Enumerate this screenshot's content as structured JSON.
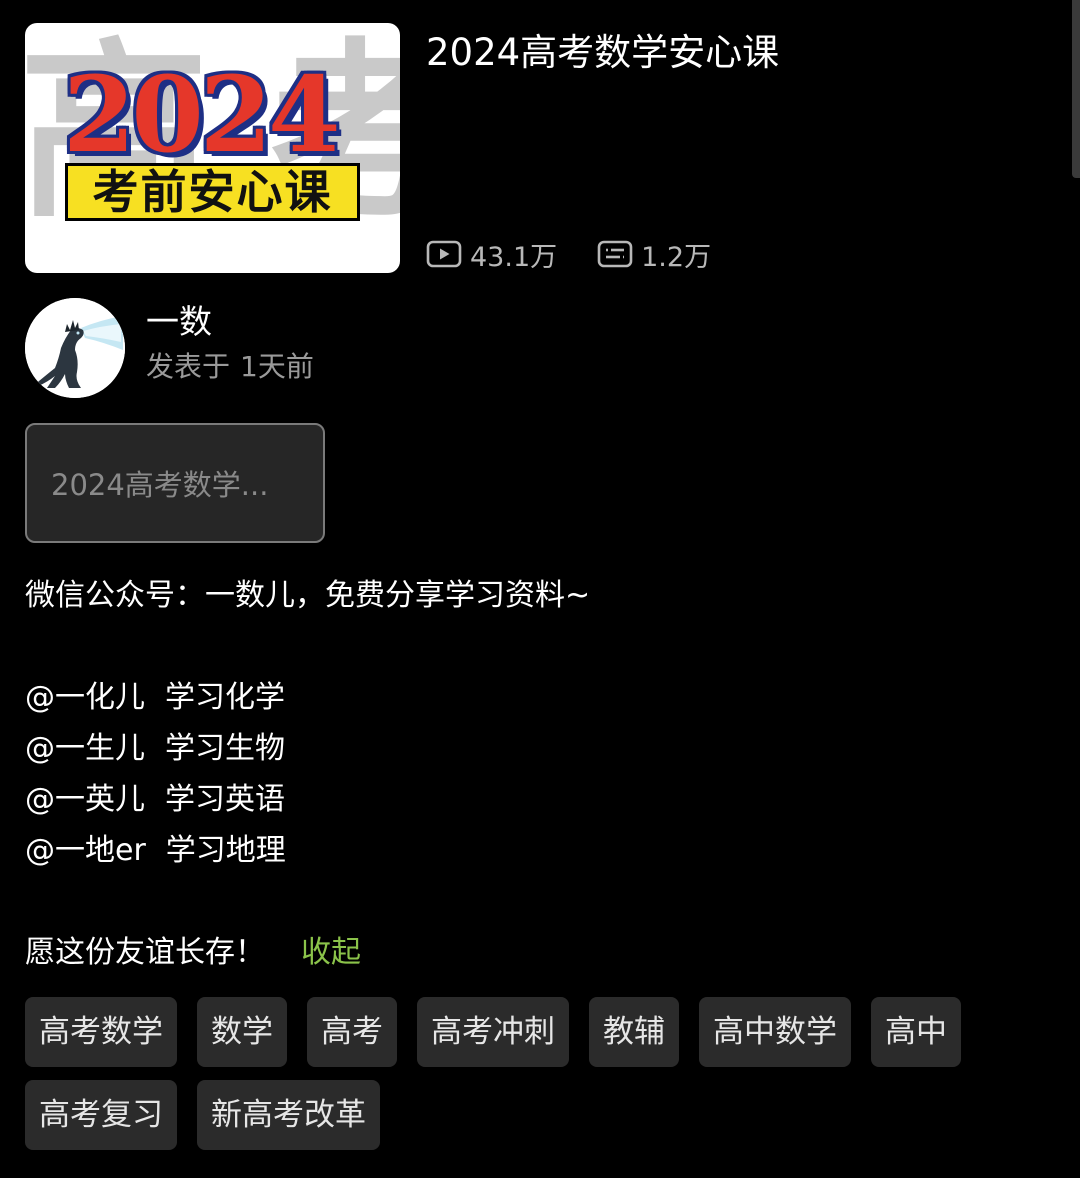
{
  "video": {
    "title": "2024高考数学安心课",
    "thumbnail": {
      "background_glyphs": "高考",
      "year_text": "2024",
      "subtitle_text": "考前安心课"
    },
    "stats": {
      "views_icon": "play-count-icon",
      "views": "43.1万",
      "danmaku_icon": "danmaku-icon",
      "danmaku": "1.2万"
    }
  },
  "author": {
    "name": "一数",
    "post_label": "发表于",
    "post_time": "1天前",
    "avatar_icon": "godzilla-avatar"
  },
  "collection": {
    "label": "2024高考数学..."
  },
  "description": {
    "lines": [
      "微信公众号：一数儿，免费分享学习资料~",
      "",
      "@一化儿",
      "@一生儿",
      "@一英儿",
      "@一地er"
    ],
    "mentions": [
      {
        "handle": "@一化儿",
        "text": "学习化学"
      },
      {
        "handle": "@一生儿",
        "text": "学习生物"
      },
      {
        "handle": "@一英儿",
        "text": "学习英语"
      },
      {
        "handle": "@一地er",
        "text": "学习地理"
      }
    ],
    "intro": "微信公众号：一数儿，免费分享学习资料~",
    "closing": "愿这份友谊长存！",
    "collapse_label": "收起"
  },
  "tags": [
    "高考数学",
    "数学",
    "高考",
    "高考冲刺",
    "教辅",
    "高中数学",
    "高中",
    "高考复习",
    "新高考改革"
  ],
  "colors": {
    "background": "#000000",
    "accent_green": "#8bc34a",
    "tag_bg": "#2b2b2b",
    "thumb_red": "#e5372a",
    "thumb_blue": "#1e2f85",
    "thumb_yellow": "#f7e022"
  }
}
